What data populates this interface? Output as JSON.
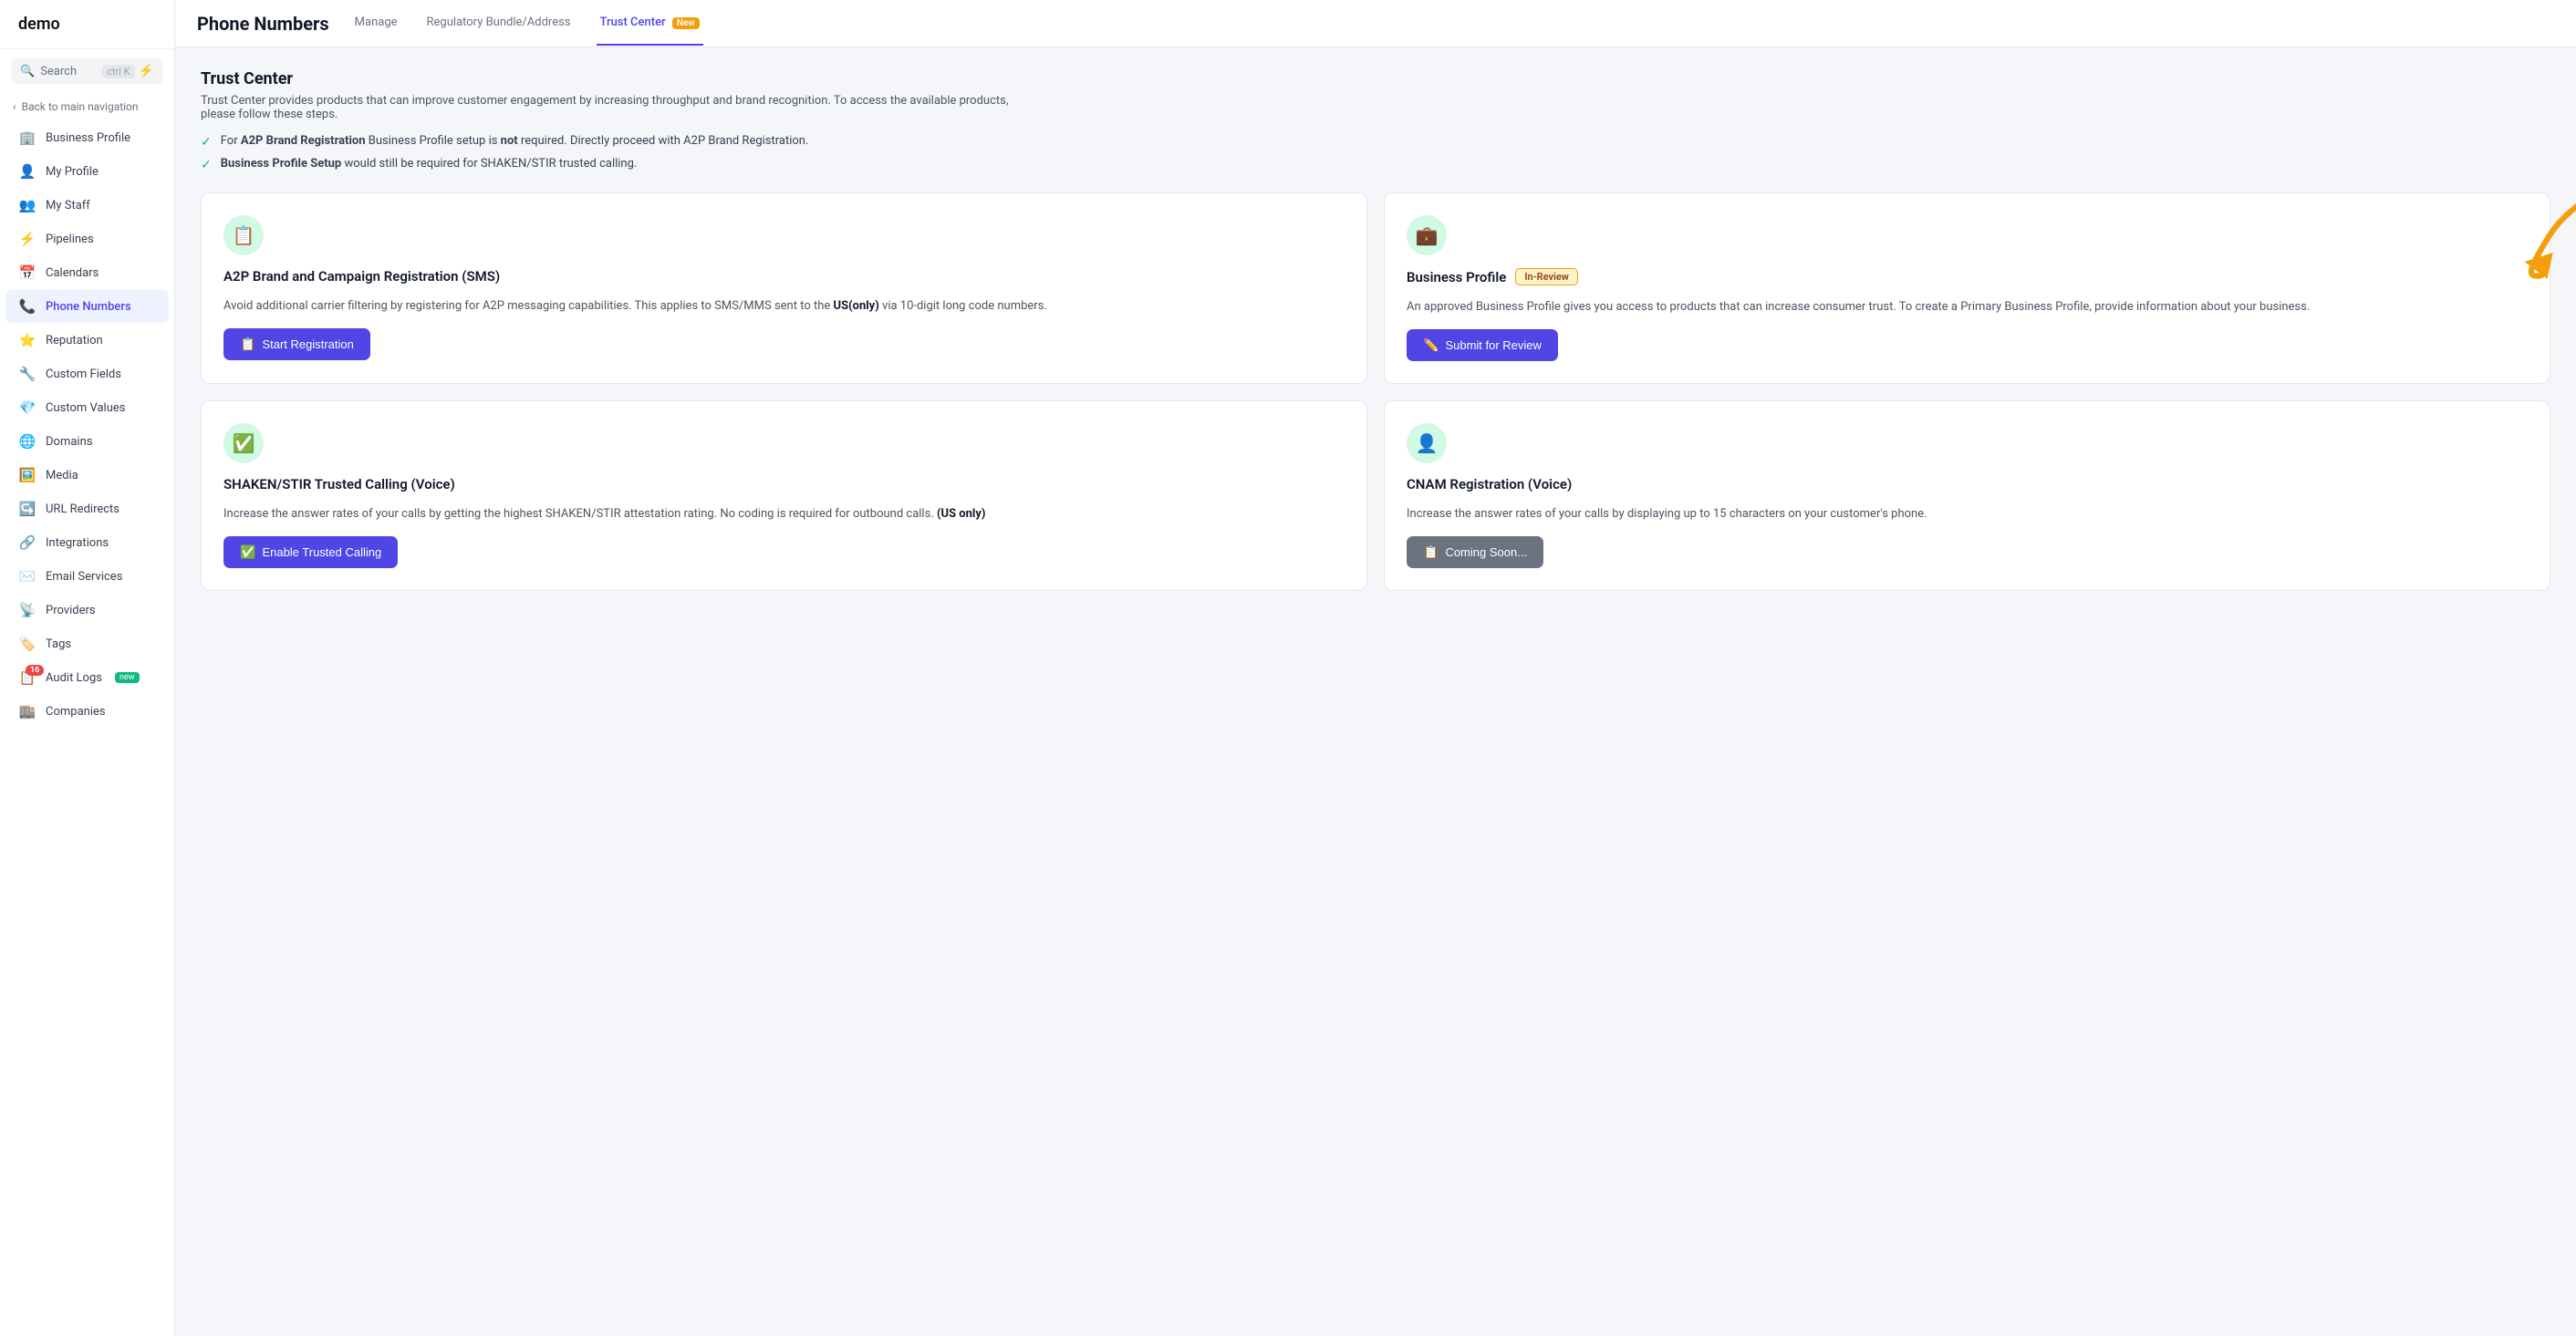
{
  "sidebar": {
    "logo": "demo",
    "search_label": "Search",
    "search_shortcut": "ctrl K",
    "back_label": "Back to main navigation",
    "items": [
      {
        "id": "business-profile",
        "label": "Business Profile",
        "icon": "🏢"
      },
      {
        "id": "my-profile",
        "label": "My Profile",
        "icon": "👤"
      },
      {
        "id": "my-staff",
        "label": "My Staff",
        "icon": "👥"
      },
      {
        "id": "pipelines",
        "label": "Pipelines",
        "icon": "⚡"
      },
      {
        "id": "calendars",
        "label": "Calendars",
        "icon": "📅"
      },
      {
        "id": "phone-numbers",
        "label": "Phone Numbers",
        "icon": "📞",
        "active": true
      },
      {
        "id": "reputation",
        "label": "Reputation",
        "icon": "⭐"
      },
      {
        "id": "custom-fields",
        "label": "Custom Fields",
        "icon": "🔧"
      },
      {
        "id": "custom-values",
        "label": "Custom Values",
        "icon": "💎"
      },
      {
        "id": "domains",
        "label": "Domains",
        "icon": "🌐"
      },
      {
        "id": "media",
        "label": "Media",
        "icon": "🖼️"
      },
      {
        "id": "url-redirects",
        "label": "URL Redirects",
        "icon": "↪️"
      },
      {
        "id": "integrations",
        "label": "Integrations",
        "icon": "🔗"
      },
      {
        "id": "email-services",
        "label": "Email Services",
        "icon": "✉️"
      },
      {
        "id": "providers",
        "label": "Providers",
        "icon": "📡"
      },
      {
        "id": "tags",
        "label": "Tags",
        "icon": "🏷️"
      },
      {
        "id": "audit-logs",
        "label": "Audit Logs",
        "icon": "📋",
        "badge": "16",
        "badge_color": "red"
      },
      {
        "id": "companies",
        "label": "Companies",
        "icon": "🏬"
      }
    ]
  },
  "header": {
    "title": "Phone Numbers",
    "tabs": [
      {
        "id": "manage",
        "label": "Manage",
        "active": false
      },
      {
        "id": "regulatory",
        "label": "Regulatory Bundle/Address",
        "active": false
      },
      {
        "id": "trust-center",
        "label": "Trust Center",
        "active": true,
        "badge": "New"
      }
    ]
  },
  "content": {
    "section_title": "Trust Center",
    "section_desc": "Trust Center provides products that can improve customer engagement by increasing throughput and brand recognition. To access the available products, please follow these steps.",
    "bullets": [
      {
        "text_html": "For <strong>A2P Brand Registration</strong> Business Profile setup is <strong>not</strong> required. Directly proceed with A2P Brand Registration."
      },
      {
        "text_html": "<strong>Business Profile Setup</strong> would still be required for SHAKEN/STIR trusted calling."
      }
    ],
    "cards": [
      {
        "id": "a2p",
        "icon": "📋",
        "title": "A2P Brand and Campaign Registration (SMS)",
        "desc": "Avoid additional carrier filtering by registering for A2P messaging capabilities. This applies to SMS/MMS sent to the <strong>US(only)</strong> via 10-digit long code numbers.",
        "btn_label": "Start Registration",
        "btn_icon": "📋",
        "badge": null,
        "position": "left"
      },
      {
        "id": "business-profile",
        "icon": "💼",
        "title": "Business Profile",
        "desc": "An approved Business Profile gives you access to products that can increase consumer trust. To create a Primary Business Profile, provide information about your business.",
        "btn_label": "Submit for Review",
        "btn_icon": "✏️",
        "badge": "In-Review",
        "position": "right"
      },
      {
        "id": "shaken-stir",
        "icon": "✅",
        "title": "SHAKEN/STIR Trusted Calling (Voice)",
        "desc": "Increase the answer rates of your calls by getting the highest SHAKEN/STIR attestation rating. No coding is required for outbound calls. <strong>(US only)</strong>",
        "btn_label": "Enable Trusted Calling",
        "btn_icon": "✅",
        "badge": null,
        "position": "left"
      },
      {
        "id": "cnam",
        "icon": "👤",
        "title": "CNAM Registration (Voice)",
        "desc": "Increase the answer rates of your calls by displaying up to 15 characters on your customer's phone.",
        "btn_label": "Coming Soon...",
        "btn_icon": "📋",
        "badge": null,
        "position": "right"
      }
    ]
  }
}
